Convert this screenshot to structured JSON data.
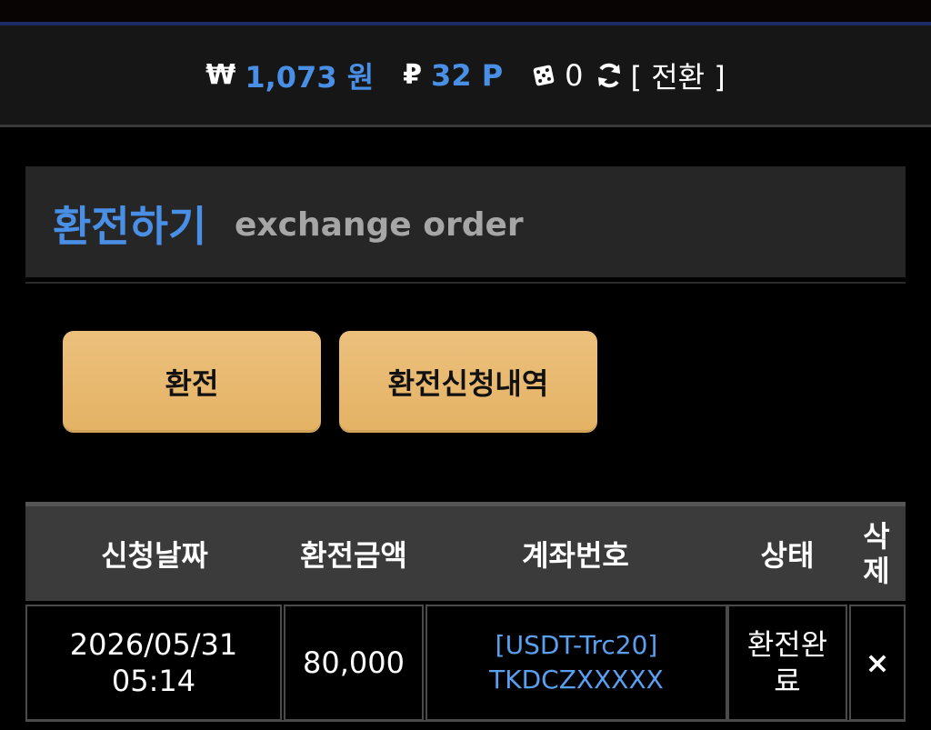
{
  "balance": {
    "won_symbol": "₩",
    "won_amount": "1,073 원",
    "point_symbol": "₽",
    "point_amount": "32 P",
    "dice_count": "0",
    "swap_label": "[ 전환 ]"
  },
  "title": {
    "ko": "환전하기",
    "en": "exchange order"
  },
  "buttons": {
    "exchange": "환전",
    "history": "환전신청내역"
  },
  "table": {
    "headers": [
      "신청날짜",
      "환전금액",
      "계좌번호",
      "상태",
      "삭제"
    ],
    "rows": [
      {
        "date": "2026/05/31",
        "time": "05:14",
        "amount": "80,000",
        "account_line1": "[USDT-Trc20]",
        "account_line2": "TKDCZXXXXX",
        "status": "환전완료",
        "delete_icon": "×"
      }
    ]
  },
  "colors": {
    "accent_blue": "#4a8fe6",
    "button_gold": "#e8b86e"
  },
  "icons": [
    "won-icon",
    "point-icon",
    "dice-icon",
    "refresh-icon",
    "delete-icon"
  ]
}
